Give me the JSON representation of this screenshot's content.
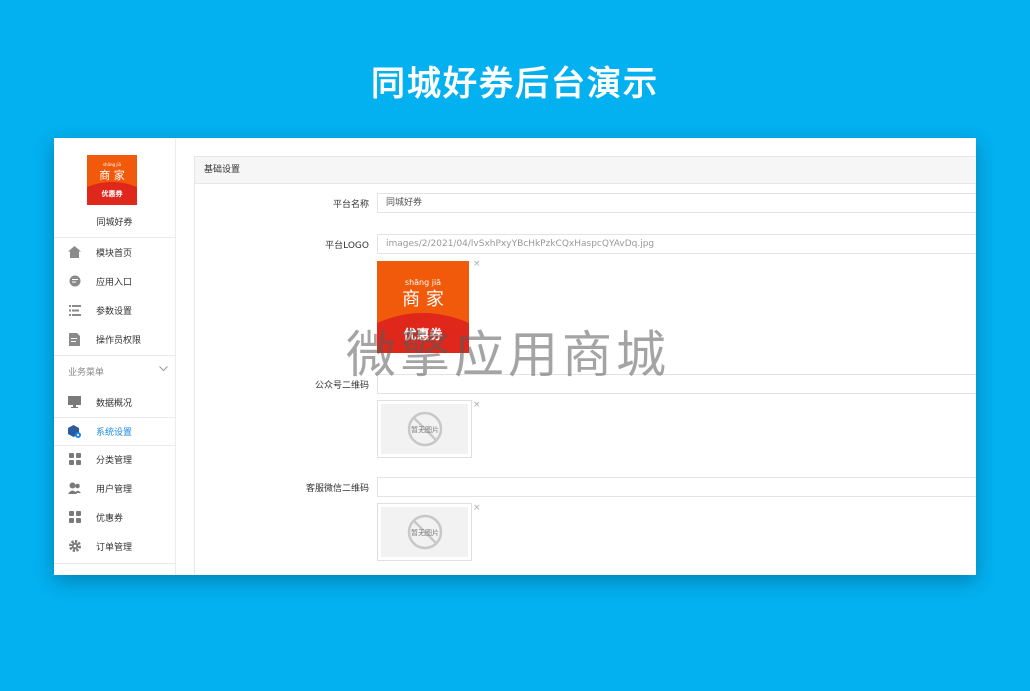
{
  "banner": {
    "title": "同城好券后台演示"
  },
  "watermark": "微擎应用商城",
  "logo": {
    "line1": "shāng  jiā",
    "line2": "商 家",
    "badge": "优惠券"
  },
  "sidebar": {
    "app_name": "同城好券",
    "top_items": [
      {
        "label": "模块首页",
        "icon": "home-icon"
      },
      {
        "label": "应用入口",
        "icon": "chat-icon"
      },
      {
        "label": "参数设置",
        "icon": "list-icon"
      },
      {
        "label": "操作员权限",
        "icon": "document-edit-icon"
      }
    ],
    "group_label": "业务菜单",
    "group_items": [
      {
        "label": "数据概况",
        "icon": "monitor-icon"
      },
      {
        "label": "系统设置",
        "icon": "settings-cube-icon",
        "active": true
      },
      {
        "label": "分类管理",
        "icon": "grid-icon"
      },
      {
        "label": "用户管理",
        "icon": "users-icon"
      },
      {
        "label": "优惠券",
        "icon": "grid-icon"
      },
      {
        "label": "订单管理",
        "icon": "gear-icon"
      }
    ]
  },
  "main": {
    "section_title": "基础设置",
    "fields": {
      "platform_name": {
        "label": "平台名称",
        "value": "同城好券"
      },
      "platform_logo": {
        "label": "平台LOGO",
        "value": "images/2/2021/04/lvSxhPxyYBcHkPzkCQxHaspcQYAvDq.jpg"
      },
      "official_qr": {
        "label": "公众号二维码",
        "value": ""
      },
      "service_qr": {
        "label": "客服微信二维码",
        "value": ""
      }
    },
    "no_image_text": "暂无图片",
    "remove_symbol": "×"
  },
  "colors": {
    "background": "#03b0f0",
    "accent": "#1e88e5",
    "logo_orange": "#f05a0a",
    "logo_red": "#e0271b"
  }
}
